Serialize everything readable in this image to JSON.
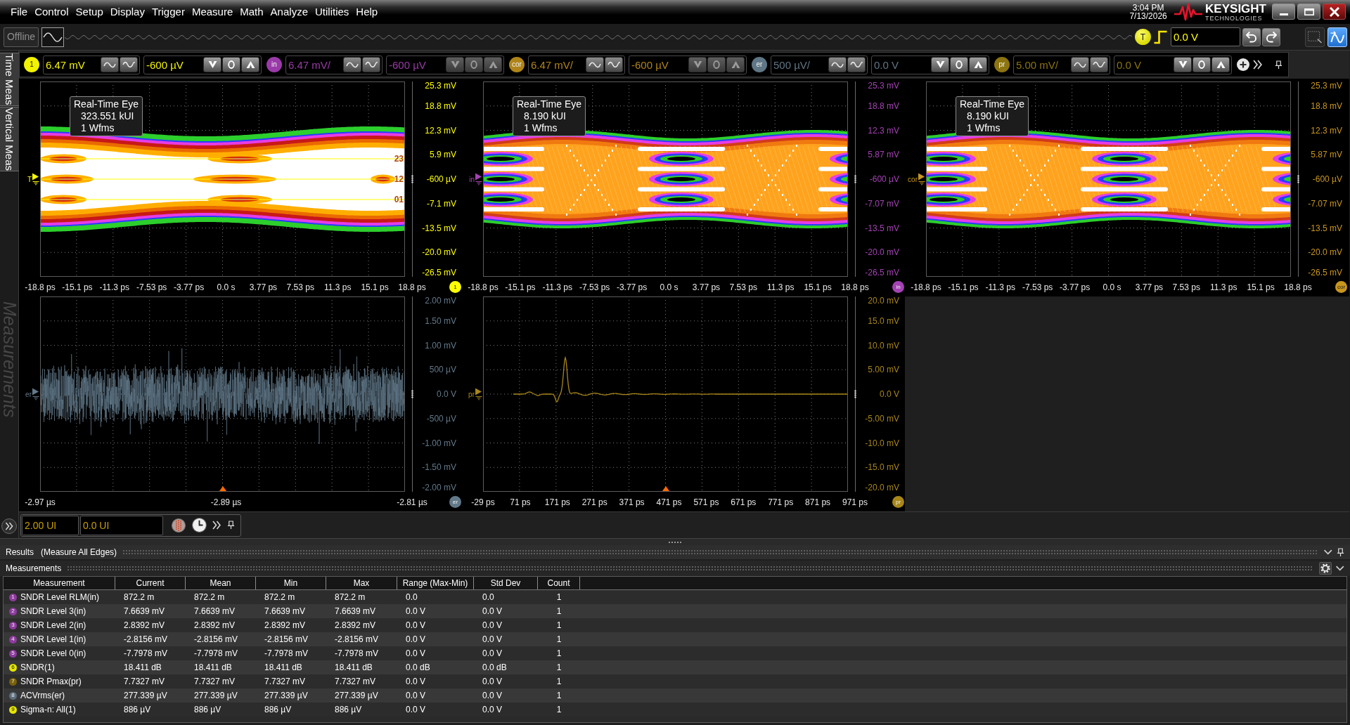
{
  "menu_bar": {
    "items": [
      "File",
      "Control",
      "Setup",
      "Display",
      "Trigger",
      "Measure",
      "Math",
      "Analyze",
      "Utilities",
      "Help"
    ],
    "clock": {
      "time": "3:04 PM",
      "date": "7/13/2026"
    },
    "logo": {
      "name": "KEYSIGHT",
      "tagline": "TECHNOLOGIES"
    }
  },
  "toolbar": {
    "mode": "Offline",
    "trigger": {
      "badge": "T",
      "level": "0.0 V"
    },
    "view_buttons": [
      {
        "selected": false
      },
      {
        "selected": true
      }
    ]
  },
  "side_tabs": [
    {
      "label": "Time Meas",
      "disabled": false
    },
    {
      "label": "Vertical Meas",
      "disabled": false
    },
    {
      "label": "Measurements",
      "disabled": true
    }
  ],
  "channels": [
    {
      "badge": "1",
      "color": "#f2f200",
      "scale": "6.47 mV",
      "offset": "-600 µV",
      "active": true
    },
    {
      "badge": "in",
      "color": "#9a3aa8",
      "scale": "6.47 mV/",
      "offset": "-600 µV",
      "active": false
    },
    {
      "badge": "cor",
      "color": "#b08418",
      "scale": "6.47 mV/",
      "offset": "-600 µV",
      "active": false
    },
    {
      "badge": "er",
      "color": "#5f7686",
      "scale": "500 µV/",
      "offset": "0.0 V",
      "active": true
    },
    {
      "badge": "pr",
      "color": "#8c7410",
      "scale": "5.00 mV/",
      "offset": "0.0 V",
      "active": true
    }
  ],
  "plot_rows": [
    {
      "plots": [
        {
          "kind": "eye",
          "badge": "1",
          "color": "#ffff00",
          "marker": "T",
          "info": [
            "Real-Time Eye",
            "323.551 kUI",
            "1 Wfms"
          ],
          "thresholds": [
            "23",
            "12",
            "01"
          ],
          "y_ticks": [
            "25.3 mV",
            "18.8 mV",
            "12.3 mV",
            "5.9 mV",
            "-600 µV",
            "-7.1 mV",
            "-13.5 mV",
            "-20.0 mV",
            "-26.5 mV"
          ],
          "x_ticks": [
            "-18.8 ps",
            "-15.1 ps",
            "-11.3 ps",
            "-7.53 ps",
            "-3.77 ps",
            "0.0 s",
            "3.77 ps",
            "7.53 ps",
            "11.3 ps",
            "15.1 ps",
            "18.8 ps"
          ],
          "reference_marker": false
        },
        {
          "kind": "denseeye",
          "badge": "in",
          "color": "#a442b4",
          "marker": "in",
          "info": [
            "Real-Time Eye",
            "8.190 kUI",
            "1 Wfms"
          ],
          "y_ticks": [
            "25.3 mV",
            "18.8 mV",
            "12.3 mV",
            "5.87 mV",
            "-600 µV",
            "-7.07 mV",
            "-13.5 mV",
            "-20.0 mV",
            "-26.5 mV"
          ],
          "x_ticks": [
            "-18.8 ps",
            "-15.1 ps",
            "-11.3 ps",
            "-7.53 ps",
            "-3.77 ps",
            "0.0 s",
            "3.77 ps",
            "7.53 ps",
            "11.3 ps",
            "15.1 ps",
            "18.8 ps"
          ],
          "reference_marker": false
        },
        {
          "kind": "denseeye",
          "badge": "cor",
          "color": "#c8961e",
          "marker": "cor",
          "info": [
            "Real-Time Eye",
            "8.190 kUI",
            "1 Wfms"
          ],
          "y_ticks": [
            "25.3 mV",
            "18.8 mV",
            "12.3 mV",
            "5.87 mV",
            "-600 µV",
            "-7.07 mV",
            "-13.5 mV",
            "-20.0 mV",
            "-26.5 mV"
          ],
          "x_ticks": [
            "-18.8 ps",
            "-15.1 ps",
            "-11.3 ps",
            "-7.53 ps",
            "-3.77 ps",
            "0.0 s",
            "3.77 ps",
            "7.53 ps",
            "11.3 ps",
            "15.1 ps",
            "18.8 ps"
          ],
          "reference_marker": false
        }
      ]
    },
    {
      "plots": [
        {
          "kind": "noise",
          "badge": "er",
          "color": "#62798a",
          "marker": "er",
          "y_ticks": [
            "2.00 mV",
            "1.50 mV",
            "1.00 mV",
            "500 µV",
            "0.0 V",
            "-500 µV",
            "-1.00 mV",
            "-1.50 mV",
            "-2.00 mV"
          ],
          "x_ticks": [
            "-2.97 µs",
            "-2.89 µs",
            "-2.81 µs"
          ],
          "reference_marker": true
        },
        {
          "kind": "pulse",
          "badge": "pr",
          "color": "#a88618",
          "marker": "pr",
          "y_ticks": [
            "20.0 mV",
            "15.0 mV",
            "10.0 mV",
            "5.00 mV",
            "0.0 V",
            "-5.00 mV",
            "-10.0 mV",
            "-15.0 mV",
            "-20.0 mV"
          ],
          "x_ticks": [
            "-29 ps",
            "71 ps",
            "171 ps",
            "271 ps",
            "371 ps",
            "471 ps",
            "571 ps",
            "671 ps",
            "771 ps",
            "871 ps",
            "971 ps"
          ],
          "reference_marker": true
        }
      ]
    }
  ],
  "eye_controls": {
    "fields": [
      "2.00 UI",
      "0.0 UI"
    ]
  },
  "results": {
    "title": "Results",
    "subtitle": "(Measure All Edges)",
    "panel_title": "Measurements",
    "columns": [
      "Measurement",
      "Current",
      "Mean",
      "Min",
      "Max",
      "Range (Max-Min)",
      "Std Dev",
      "Count"
    ],
    "rows": [
      {
        "index": "1",
        "color": "#8e3a9e",
        "cells": [
          "SNDR Level RLM(in)",
          "872.2 m",
          "872.2 m",
          "872.2 m",
          "872.2 m",
          "0.0",
          "0.0",
          "1"
        ]
      },
      {
        "index": "2",
        "color": "#8e3a9e",
        "cells": [
          "SNDR Level 3(in)",
          "7.6639 mV",
          "7.6639 mV",
          "7.6639 mV",
          "7.6639 mV",
          "0.0 V",
          "0.0 V",
          "1"
        ]
      },
      {
        "index": "3",
        "color": "#8e3a9e",
        "cells": [
          "SNDR Level 2(in)",
          "2.8392 mV",
          "2.8392 mV",
          "2.8392 mV",
          "2.8392 mV",
          "0.0 V",
          "0.0 V",
          "1"
        ]
      },
      {
        "index": "4",
        "color": "#8e3a9e",
        "cells": [
          "SNDR Level 1(in)",
          "-2.8156 mV",
          "-2.8156 mV",
          "-2.8156 mV",
          "-2.8156 mV",
          "0.0 V",
          "0.0 V",
          "1"
        ]
      },
      {
        "index": "5",
        "color": "#8e3a9e",
        "cells": [
          "SNDR Level 0(in)",
          "-7.7978 mV",
          "-7.7978 mV",
          "-7.7978 mV",
          "-7.7978 mV",
          "0.0 V",
          "0.0 V",
          "1"
        ]
      },
      {
        "index": "6",
        "color": "#e6e600",
        "cells": [
          "SNDR(1)",
          "18.411 dB",
          "18.411 dB",
          "18.411 dB",
          "18.411 dB",
          "0.0 dB",
          "0.0 dB",
          "1"
        ]
      },
      {
        "index": "7",
        "color": "#7a6008",
        "cells": [
          "SNDR Pmax(pr)",
          "7.7327 mV",
          "7.7327 mV",
          "7.7327 mV",
          "7.7327 mV",
          "0.0 V",
          "0.0 V",
          "1"
        ]
      },
      {
        "index": "8",
        "color": "#5a6e7c",
        "cells": [
          "ACVrms(er)",
          "277.339 µV",
          "277.339 µV",
          "277.339 µV",
          "277.339 µV",
          "0.0 V",
          "0.0 V",
          "1"
        ]
      },
      {
        "index": "9",
        "color": "#e6e600",
        "cells": [
          "Sigma-n: All(1)",
          "886 µV",
          "886 µV",
          "886 µV",
          "886 µV",
          "0.0 V",
          "0.0 V",
          "1"
        ]
      }
    ]
  }
}
